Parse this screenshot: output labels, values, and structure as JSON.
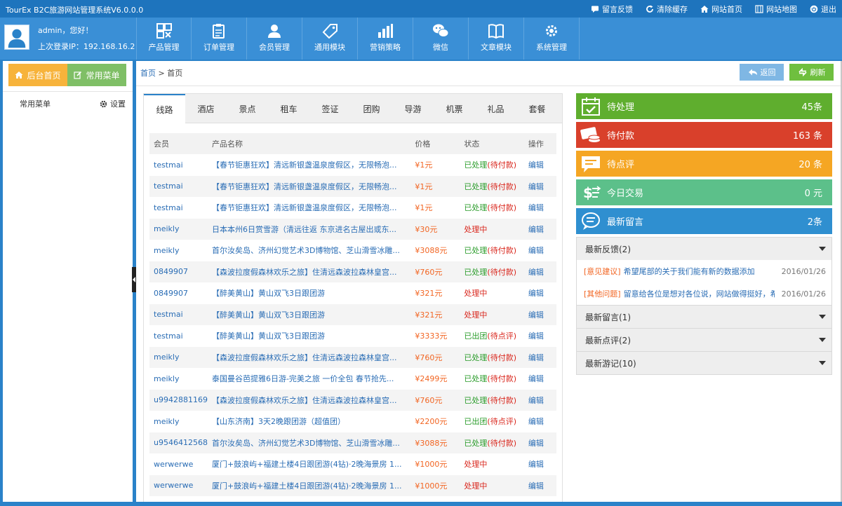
{
  "app": {
    "title": "TourEx B2C旅游网站管理系统V6.0.0.0",
    "top_links": [
      {
        "label": "留言反馈",
        "icon": "chat-icon"
      },
      {
        "label": "清除缓存",
        "icon": "refresh-icon"
      },
      {
        "label": "网站首页",
        "icon": "home-icon"
      },
      {
        "label": "网站地图",
        "icon": "map-icon"
      },
      {
        "label": "退出",
        "icon": "power-icon"
      }
    ]
  },
  "user": {
    "greeting": "admin，您好！",
    "last_login": "上次登录IP：192.168.16.2"
  },
  "nav": [
    {
      "label": "产品管理",
      "icon": "grid-icon"
    },
    {
      "label": "订单管理",
      "icon": "clipboard-icon"
    },
    {
      "label": "会员管理",
      "icon": "user-icon"
    },
    {
      "label": "通用模块",
      "icon": "tag-icon"
    },
    {
      "label": "营销策略",
      "icon": "bar-chart-icon"
    },
    {
      "label": "微信",
      "icon": "wechat-icon"
    },
    {
      "label": "文章模块",
      "icon": "book-icon"
    },
    {
      "label": "系统管理",
      "icon": "gear-icon"
    }
  ],
  "sidebar": {
    "home_tab": "后台首页",
    "menu_tab": "常用菜单",
    "common_menu": "常用菜单",
    "settings": "设置"
  },
  "breadcrumb": {
    "root": "首页",
    "sep": ">",
    "current": "首页"
  },
  "actions": {
    "back": "返回",
    "refresh": "刷新"
  },
  "product_tabs": [
    "线路",
    "酒店",
    "景点",
    "租车",
    "签证",
    "团购",
    "导游",
    "机票",
    "礼品",
    "套餐"
  ],
  "orders": {
    "headers": {
      "member": "会员",
      "name": "产品名称",
      "price": "价格",
      "status": "状态",
      "op": "操作"
    },
    "rows": [
      {
        "member": "testmai",
        "name": "【春节钜惠狂欢】清远新银盏温泉度假区，无限畅泡...",
        "price": "¥1元",
        "status_main": "已处理",
        "status_sub": "(待付款)",
        "op": "编辑"
      },
      {
        "member": "testmai",
        "name": "【春节钜惠狂欢】清远新银盏温泉度假区，无限畅泡...",
        "price": "¥1元",
        "status_main": "已处理",
        "status_sub": "(待付款)",
        "op": "编辑"
      },
      {
        "member": "testmai",
        "name": "【春节钜惠狂欢】清远新银盏温泉度假区，无限畅泡...",
        "price": "¥1元",
        "status_main": "已处理",
        "status_sub": "(待付款)",
        "op": "编辑"
      },
      {
        "member": "meikly",
        "name": "日本本州6日赏雪游（清远往返 东京进名古屋出或东...",
        "price": "¥30元",
        "status_main": "处理中",
        "status_sub": "",
        "op": "编辑"
      },
      {
        "member": "meikly",
        "name": "首尔汝矣岛、济州幻觉艺术3D博物馆、芝山滑雪冰雕...",
        "price": "¥3088元",
        "status_main": "已处理",
        "status_sub": "(待付款)",
        "op": "编辑"
      },
      {
        "member": "0849907",
        "name": "【森波拉度假森林欢乐之旅】住清远森波拉森林皇宫...",
        "price": "¥760元",
        "status_main": "已处理",
        "status_sub": "(待付款)",
        "op": "编辑"
      },
      {
        "member": "0849907",
        "name": "【醉美黄山】黄山双飞3日跟团游",
        "price": "¥321元",
        "status_main": "处理中",
        "status_sub": "",
        "op": "编辑"
      },
      {
        "member": "testmai",
        "name": "【醉美黄山】黄山双飞3日跟团游",
        "price": "¥321元",
        "status_main": "处理中",
        "status_sub": "",
        "op": "编辑"
      },
      {
        "member": "testmai",
        "name": "【醉美黄山】黄山双飞3日跟团游",
        "price": "¥3333元",
        "status_main": "已出团",
        "status_sub": "(待点评)",
        "op": "编辑"
      },
      {
        "member": "meikly",
        "name": "【森波拉度假森林欢乐之旅】住清远森波拉森林皇宫...",
        "price": "¥760元",
        "status_main": "已处理",
        "status_sub": "(待付款)",
        "op": "编辑"
      },
      {
        "member": "meikly",
        "name": "泰国曼谷芭提雅6日游-完美之旅 一价全包 春节抢先...",
        "price": "¥2499元",
        "status_main": "已处理",
        "status_sub": "(待付款)",
        "op": "编辑"
      },
      {
        "member": "u9942881169",
        "name": "【森波拉度假森林欢乐之旅】住清远森波拉森林皇宫...",
        "price": "¥760元",
        "status_main": "已处理",
        "status_sub": "(待付款)",
        "op": "编辑"
      },
      {
        "member": "meikly",
        "name": "【山东济南】3天2晚跟团游（超值团）",
        "price": "¥2200元",
        "status_main": "已出团",
        "status_sub": "(待点评)",
        "op": "编辑"
      },
      {
        "member": "u9546412568",
        "name": "首尔汝矣岛、济州幻觉艺术3D博物馆、芝山滑雪冰雕...",
        "price": "¥3088元",
        "status_main": "已处理",
        "status_sub": "(待付款)",
        "op": "编辑"
      },
      {
        "member": "werwerwe",
        "name": "厦门+鼓浪屿+福建土楼4日跟团游(4钻)·2晚海景房 1...",
        "price": "¥1000元",
        "status_main": "处理中",
        "status_sub": "",
        "op": "编辑"
      },
      {
        "member": "werwerwe",
        "name": "厦门+鼓浪屿+福建土楼4日跟团游(4钻)·2晚海景房 1...",
        "price": "¥1000元",
        "status_main": "处理中",
        "status_sub": "",
        "op": "编辑"
      }
    ]
  },
  "stats": [
    {
      "label": "待处理",
      "value": "45条",
      "color": "#5fae2e",
      "icon": "calendar-check-icon"
    },
    {
      "label": "待付款",
      "value": "163 条",
      "color": "#d9402b",
      "icon": "credit-card-icon"
    },
    {
      "label": "待点评",
      "value": "20 条",
      "color": "#f5a623",
      "icon": "comment-icon"
    },
    {
      "label": "今日交易",
      "value": "0 元",
      "color": "#5cc08a",
      "icon": "money-icon"
    },
    {
      "label": "最新留言",
      "value": "2条",
      "color": "#2f8fd0",
      "icon": "message-icon"
    }
  ],
  "feedback": {
    "sections": [
      {
        "title": "最新反馈(2)"
      },
      {
        "title": "最新留言(1)"
      },
      {
        "title": "最新点评(2)"
      },
      {
        "title": "最新游记(10)"
      }
    ],
    "items": [
      {
        "category": "[意见建议]",
        "text": "希望尾部的关于我们能有新的数据添加",
        "date": "2016/01/26"
      },
      {
        "category": "[其他问题]",
        "text": "留意给各位是想对各位说，网站做得挺好，希",
        "date": "2016/01/26"
      }
    ]
  }
}
